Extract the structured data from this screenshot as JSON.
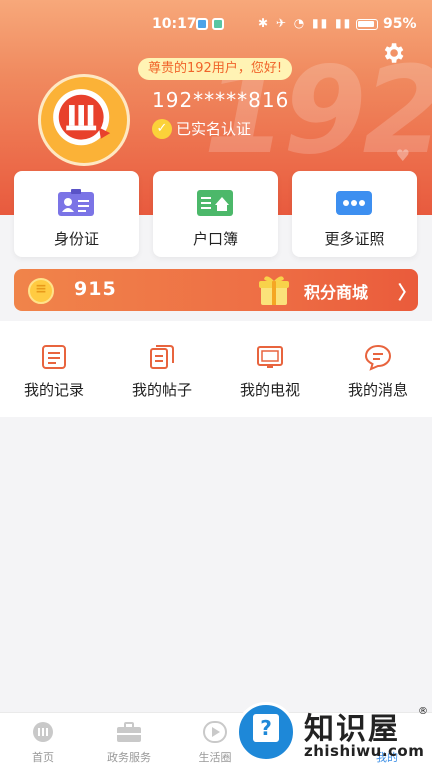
{
  "status_bar": {
    "time": "10:17",
    "battery": "95%",
    "icons": "✱ ✈ ◔ ▮▮ ▮▮"
  },
  "profile": {
    "greeting": "尊贵的192用户，您好!",
    "bg_number": "192",
    "phone": "192*****816",
    "verified_label": "已实名认证"
  },
  "cards": [
    {
      "label": "身份证",
      "icon": "id-card-icon",
      "color": "#6f6fe0"
    },
    {
      "label": "户口簿",
      "icon": "household-register-icon",
      "color": "#4cb86a"
    },
    {
      "label": "更多证照",
      "icon": "more-icon",
      "color": "#3d8ff0"
    }
  ],
  "points": {
    "value": "915",
    "mall_label": "积分商城",
    "arrow": "〉"
  },
  "menu": [
    {
      "label": "我的记录",
      "icon": "record-icon"
    },
    {
      "label": "我的帖子",
      "icon": "post-icon"
    },
    {
      "label": "我的电视",
      "icon": "tv-icon"
    },
    {
      "label": "我的消息",
      "icon": "message-icon"
    }
  ],
  "tabs": [
    {
      "label": "首页",
      "icon": "home-icon"
    },
    {
      "label": "政务服务",
      "icon": "briefcase-icon"
    },
    {
      "label": "生活圈",
      "icon": "play-icon"
    },
    {
      "label": "",
      "icon": "mall-icon"
    },
    {
      "label": "我的",
      "icon": "profile-icon"
    }
  ],
  "watermark": {
    "brand": "知识屋",
    "url": "zhishiwu.com",
    "reg": "®"
  },
  "colors": {
    "accent": "#ec6c4a",
    "card_bg": "#ffffff",
    "active_tab": "#3a8ee6"
  }
}
